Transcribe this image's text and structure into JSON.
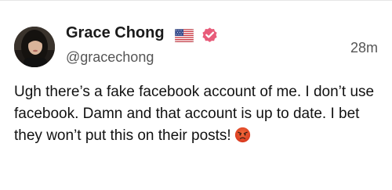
{
  "post": {
    "author": {
      "display_name": "Grace Chong",
      "handle": "@gracechong",
      "flag_icon": "us-flag-icon",
      "verified_icon": "verified-badge-icon"
    },
    "timestamp": "28m",
    "body_text": "Ugh there’s a fake facebook account of me. I don’t use facebook. Damn and that account is up to date. I bet they won’t put this on their posts!",
    "body_emoji": "angry-face-emoji",
    "colors": {
      "verified_badge": "#e85c7a",
      "text": "#111111",
      "muted_text": "#555555"
    }
  }
}
